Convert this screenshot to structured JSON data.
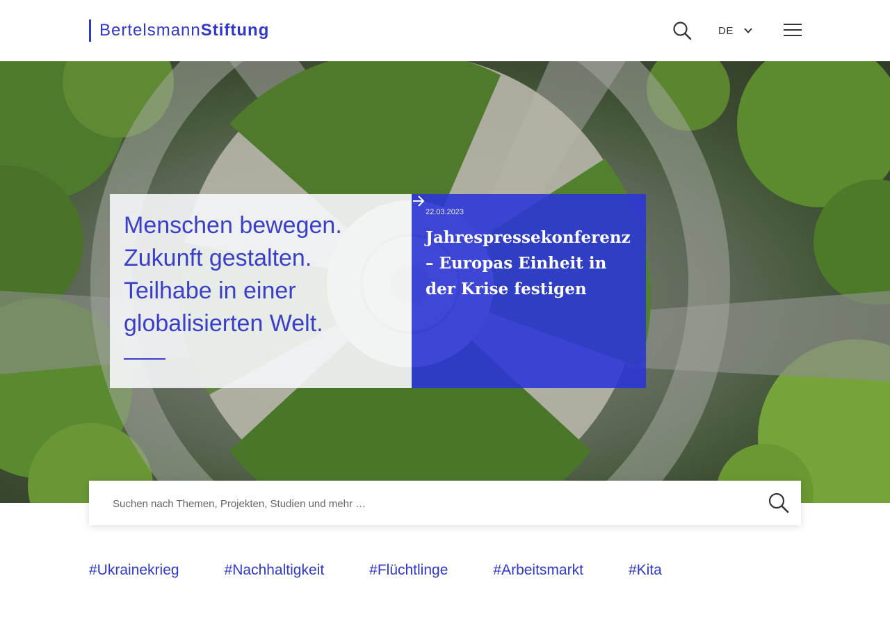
{
  "header": {
    "logo_part1": "Bertelsmann",
    "logo_part2": "Stiftung",
    "language": "DE",
    "icons": [
      "search-icon",
      "chevron-down-icon",
      "hamburger-menu-icon"
    ]
  },
  "hero": {
    "statement": "Menschen bewegen.\nZukunft gestalten.\nTeilhabe in einer\nglobalisierten Welt.",
    "news": {
      "date": "22.03.2023",
      "title": "Jahrespressekonferenz – Europas Einheit in der Krise festigen",
      "icon": "arrow-right-icon"
    }
  },
  "search": {
    "placeholder": "Suchen nach Themen, Projekten, Studien und mehr …",
    "icon": "search-icon"
  },
  "tags": [
    "#Ukrainekrieg",
    "#Nachhaltigkeit",
    "#Flüchtlinge",
    "#Arbeitsmarkt",
    "#Kita"
  ],
  "colors": {
    "brand_blue": "#2f38c9",
    "news_panel": "#2a34d8",
    "statement_panel": "#f6f7fa"
  }
}
